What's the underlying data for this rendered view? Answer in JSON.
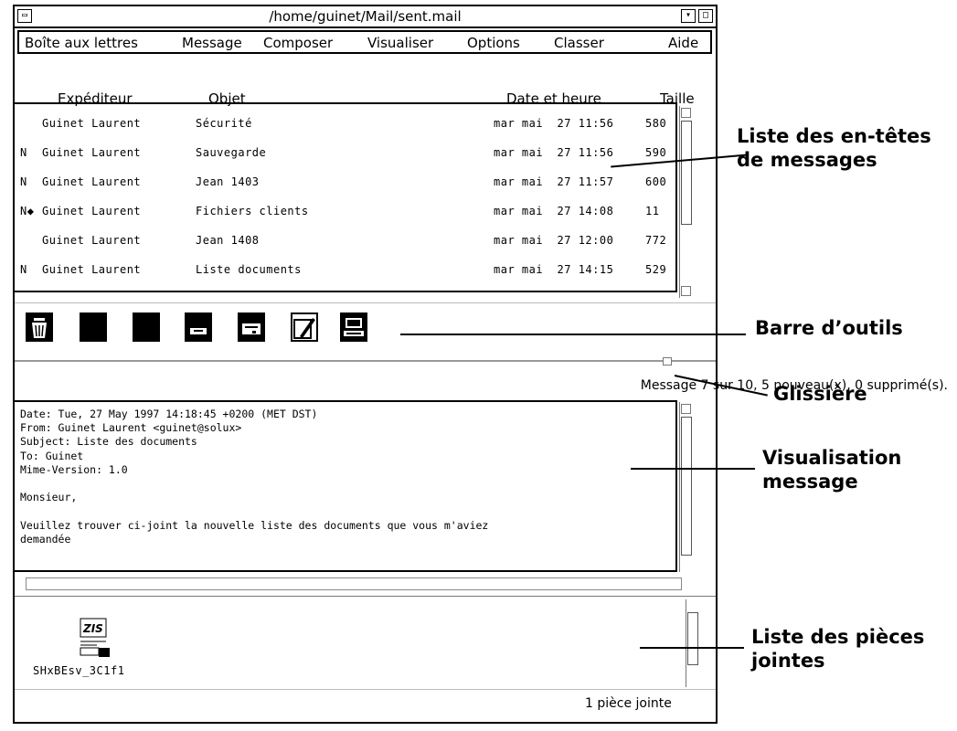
{
  "window": {
    "title": "/home/guinet/Mail/sent.mail"
  },
  "menu": {
    "items": [
      "Boîte aux lettres",
      "Message",
      "Composer",
      "Visualiser",
      "Options",
      "Classer",
      "Aide"
    ]
  },
  "columns": {
    "sender": "Expéditeur",
    "subject": "Objet",
    "date": "Date et heure",
    "size": "Taille"
  },
  "messages": [
    {
      "flag": "",
      "sender": "Guinet Laurent",
      "subject": "Sécurité",
      "date": "mar mai  27 11:56",
      "size": "580"
    },
    {
      "flag": "N",
      "sender": "Guinet Laurent",
      "subject": "Sauvegarde",
      "date": "mar mai  27 11:56",
      "size": "590"
    },
    {
      "flag": "N",
      "sender": "Guinet Laurent",
      "subject": "Jean 1403",
      "date": "mar mai  27 11:57",
      "size": "600"
    },
    {
      "flag": "N◆",
      "sender": "Guinet Laurent",
      "subject": "Fichiers clients",
      "date": "mar mai  27 14:08",
      "size": "11"
    },
    {
      "flag": "",
      "sender": "Guinet Laurent",
      "subject": "Jean 1408",
      "date": "mar mai  27 12:00",
      "size": "772"
    },
    {
      "flag": "N",
      "sender": "Guinet Laurent",
      "subject": "Liste documents",
      "date": "mar mai  27 14:15",
      "size": "529"
    }
  ],
  "toolbar": {
    "icons": [
      "delete-icon",
      "blank-icon-1",
      "blank-icon-2",
      "print-icon",
      "save-icon",
      "compose-icon",
      "reply-icon"
    ]
  },
  "status": {
    "text": "Message 7 sur 10, 5 nouveau(x), 0 supprimé(s)."
  },
  "message_view": {
    "text": "Date: Tue, 27 May 1997 14:18:45 +0200 (MET DST)\nFrom: Guinet Laurent <guinet@solux>\nSubject: Liste des documents\nTo: Guinet\nMime-Version: 1.0\n\nMonsieur,\n\nVeuillez trouver ci-joint la nouvelle liste des documents que vous m'aviez\ndemandée"
  },
  "attachments": {
    "file_name": "SHxBEsv_3C1f1",
    "icon_label": "ZIS",
    "count": "1 pièce jointe"
  },
  "annotations": {
    "headers": "Liste des en-têtes\nde messages",
    "toolbar": "Barre d’outils",
    "slider": "Glissière",
    "view": "Visualisation\nmessage",
    "attachments": "Liste des pièces\njointes"
  }
}
